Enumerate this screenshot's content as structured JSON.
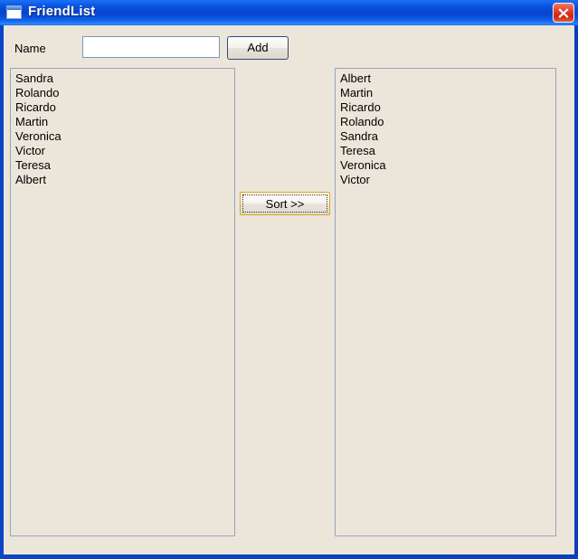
{
  "window": {
    "title": "FriendList",
    "icon": "window-icon",
    "close_label": "Close",
    "border_color": "#0a46c8",
    "titlebar_color": "#0b55e0",
    "client_background": "#ece6da"
  },
  "form": {
    "name_label": "Name",
    "name_value": "",
    "name_placeholder": "",
    "add_label": "Add",
    "sort_label": "Sort >>"
  },
  "lists": {
    "unsorted": {
      "name": "friend-list-unsorted",
      "items": [
        "Sandra",
        "Rolando",
        "Ricardo",
        "Martin",
        "Veronica",
        "Victor",
        "Teresa",
        "Albert"
      ]
    },
    "sorted": {
      "name": "friend-list-sorted",
      "items": [
        "Albert",
        "Martin",
        "Ricardo",
        "Rolando",
        "Sandra",
        "Teresa",
        "Veronica",
        "Victor"
      ]
    }
  }
}
